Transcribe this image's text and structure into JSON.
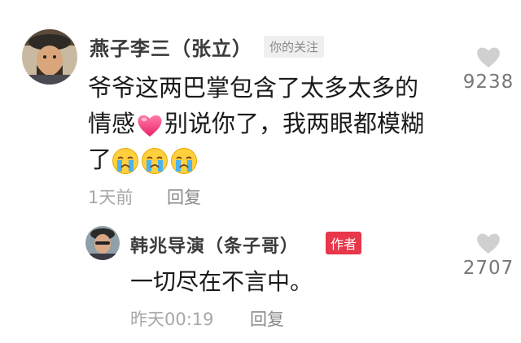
{
  "comments": [
    {
      "username": "燕子李三（张立）",
      "tag": "你的关注",
      "lines": [
        "爷爷这两巴掌包含了太多太多的",
        "情感",
        "别说你了，我两眼都模糊",
        "了"
      ],
      "time": "1天前",
      "reply_label": "回复",
      "likes": "9238"
    },
    {
      "username": "韩兆导演（条子哥）",
      "tag": "作者",
      "lines": [
        "一切尽在不言中。"
      ],
      "time": "昨天00:19",
      "reply_label": "回复",
      "likes": "2707"
    }
  ],
  "colors": {
    "author_tag_bg": "#e8364b",
    "follow_tag_bg": "#efefef",
    "like_icon": "#d0d0d0"
  },
  "icons": {
    "like": "heart-icon",
    "inline_emoji_1": "heart-emoji",
    "inline_emoji_2": "crying-face-emoji"
  }
}
